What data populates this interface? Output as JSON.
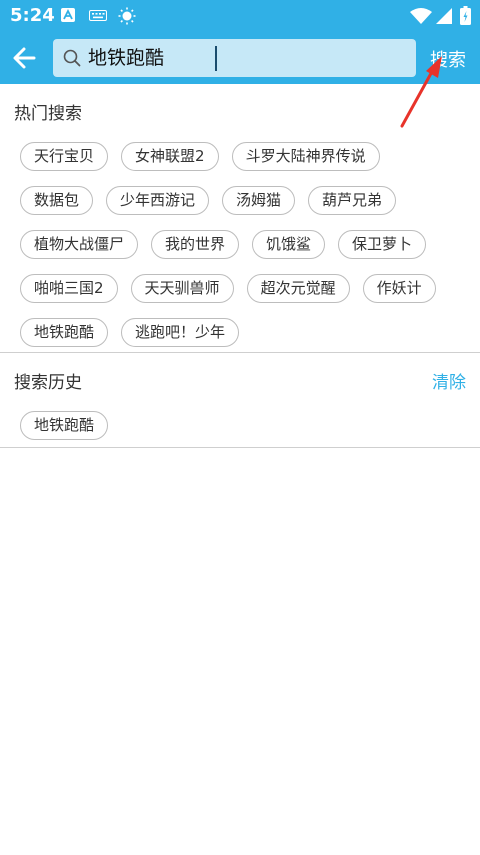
{
  "status": {
    "time": "5:24"
  },
  "search": {
    "query": "地铁跑酷",
    "button": "搜索"
  },
  "hot": {
    "title": "热门搜索",
    "rows": [
      [
        "天行宝贝",
        "女神联盟2",
        "斗罗大陆神界传说"
      ],
      [
        "数据包",
        "少年西游记",
        "汤姆猫",
        "葫芦兄弟"
      ],
      [
        "植物大战僵尸",
        "我的世界",
        "饥饿鲨",
        "保卫萝卜"
      ],
      [
        "啪啪三国2",
        "天天驯兽师",
        "超次元觉醒",
        "作妖计"
      ],
      [
        "地铁跑酷",
        "逃跑吧！少年"
      ]
    ]
  },
  "history": {
    "title": "搜索历史",
    "clear": "清除",
    "items": [
      "地铁跑酷"
    ]
  },
  "colors": {
    "accent": "#30b0e6",
    "annotation": "#e8332a"
  }
}
